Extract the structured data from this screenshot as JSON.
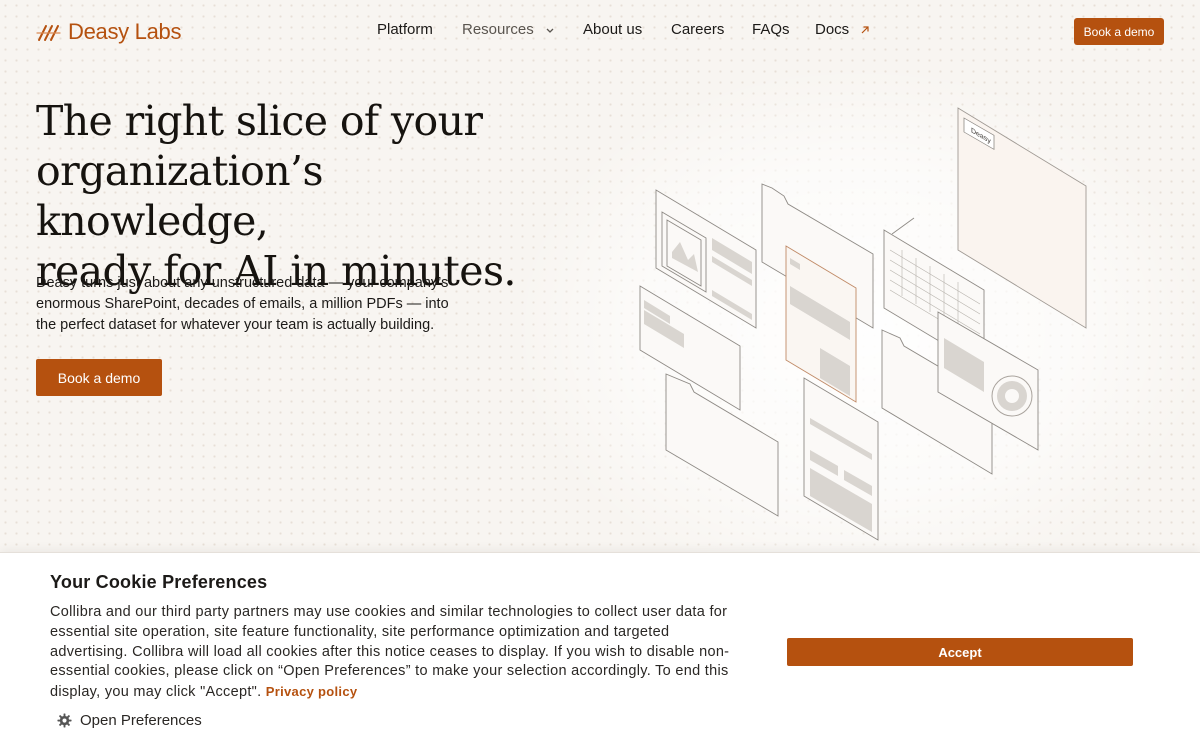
{
  "brand": {
    "name": "Deasy Labs",
    "accent": "#b5510f"
  },
  "nav": {
    "items": [
      {
        "label": "Platform"
      },
      {
        "label": "Resources"
      },
      {
        "label": "About us"
      },
      {
        "label": "Careers"
      },
      {
        "label": "FAQs"
      },
      {
        "label": "Docs"
      }
    ],
    "cta": "Book a demo"
  },
  "hero": {
    "title_lines": [
      "The right slice of your",
      "organization’s knowledge,",
      "ready for AI in minutes."
    ],
    "subtitle_lines": [
      "Deasy turns just about any unstructured data — your company’s",
      "enormous SharePoint, decades of emails, a million PDFs — into",
      "the perfect dataset for whatever your team is actually building."
    ],
    "cta": "Book a demo",
    "illustration_label": "Deasy"
  },
  "cookie": {
    "title": "Your Cookie Preferences",
    "body": "Collibra and our third party partners may use cookies and similar technologies to collect user data for essential site operation, site feature functionality, site performance optimization and targeted advertising. Collibra will load all cookies after this notice ceases to display. If you wish to disable non-essential cookies, please click on “Open Preferences” to make your selection accordingly. To end this display, you may click \"Accept\".",
    "privacy_link": "Privacy policy",
    "open_preferences": "Open Preferences",
    "accept": "Accept"
  }
}
